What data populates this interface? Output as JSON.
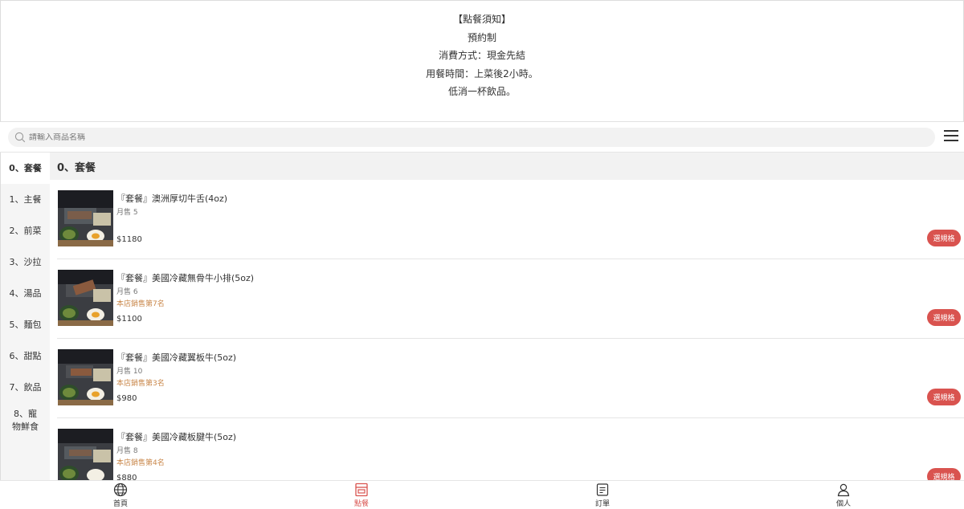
{
  "notice": {
    "lines": [
      "【點餐須知】",
      "預約制",
      "消費方式：現金先結",
      "用餐時間：上菜後2小時。",
      "低消一杯飲品。"
    ]
  },
  "search": {
    "placeholder": "請輸入商品名稱",
    "icon": "search-icon"
  },
  "menu_icon": "menu-icon",
  "categories": [
    "0、套餐",
    "1、主餐",
    "2、前菜",
    "3、沙拉",
    "4、湯品",
    "5、麵包",
    "6、甜點",
    "7、飲品",
    "8、寵物鮮食"
  ],
  "active_category": "0、套餐",
  "section_title": "0、套餐",
  "items": [
    {
      "name": "『套餐』澳洲厚切牛舌(4oz)",
      "sold": "月售 5",
      "rank": "",
      "price": "$1180",
      "button": "選規格"
    },
    {
      "name": "『套餐』美國冷藏無骨牛小排(5oz)",
      "sold": "月售 6",
      "rank": "本店銷售第7名",
      "price": "$1100",
      "button": "選規格"
    },
    {
      "name": "『套餐』美國冷藏翼板牛(5oz)",
      "sold": "月售 10",
      "rank": "本店銷售第3名",
      "price": "$980",
      "button": "選規格"
    },
    {
      "name": "『套餐』美國冷藏板腱牛(5oz)",
      "sold": "月售 8",
      "rank": "本店銷售第4名",
      "price": "$880",
      "button": "選規格"
    }
  ],
  "nav": [
    {
      "label": "首頁",
      "icon": "globe-icon"
    },
    {
      "label": "點餐",
      "icon": "store-icon"
    },
    {
      "label": "訂單",
      "icon": "receipt-icon"
    },
    {
      "label": "個人",
      "icon": "user-icon"
    }
  ],
  "colors": {
    "accent": "#d9534f",
    "rank": "#c9874a"
  }
}
